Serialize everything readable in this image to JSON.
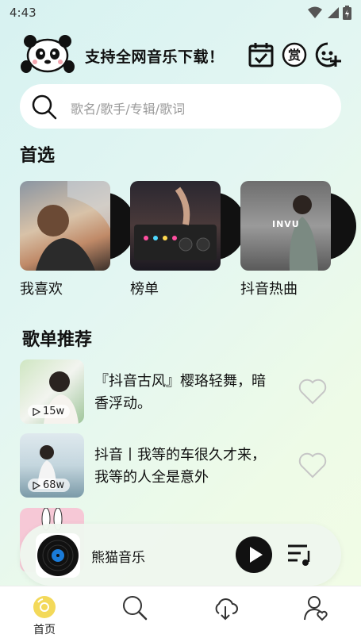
{
  "status": {
    "time": "4:43"
  },
  "header": {
    "slogan": "支持全网音乐下载！"
  },
  "search": {
    "placeholder": "歌名/歌手/专辑/歌词"
  },
  "featured": {
    "title": "首选",
    "items": [
      {
        "label": "我喜欢"
      },
      {
        "label": "榜单"
      },
      {
        "label": "抖音热曲",
        "cover_text": "INVU"
      }
    ]
  },
  "recommend": {
    "title": "歌单推荐",
    "items": [
      {
        "title": "『抖音古风』樱珞轻舞，暗香浮动。",
        "plays": "15w"
      },
      {
        "title": "抖音丨我等的车很久才来，我等的人全是意外",
        "plays": "68w"
      },
      {
        "title": "",
        "plays": ""
      }
    ]
  },
  "player": {
    "track": "熊猫音乐"
  },
  "tabs": [
    {
      "label": "首页",
      "icon": "home-disc-icon",
      "active": true
    },
    {
      "label": "",
      "icon": "search-icon"
    },
    {
      "label": "",
      "icon": "cloud-download-icon"
    },
    {
      "label": "",
      "icon": "profile-heart-icon"
    }
  ],
  "colors": {
    "accent": "#f3d95a",
    "background": "#e3f6f2",
    "text": "#111111"
  }
}
